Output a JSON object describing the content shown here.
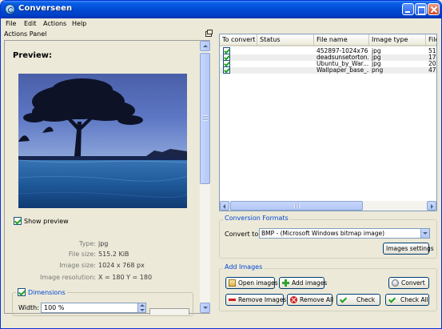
{
  "window": {
    "title": "Converseen"
  },
  "menu": [
    "File",
    "Edit",
    "Actions",
    "Help"
  ],
  "actions_panel": {
    "title": "Actions Panel",
    "preview_heading": "Preview:",
    "show_preview_label": "Show preview",
    "show_preview_checked": true,
    "info": [
      {
        "label": "Type:",
        "value": "jpg"
      },
      {
        "label": "File size:",
        "value": "515.2 KiB"
      },
      {
        "label": "Image size:",
        "value": "1024 x 768 px"
      },
      {
        "label": "Image resolution:",
        "value": "X = 180 Y = 180"
      }
    ],
    "dimensions_label": "Dimensions",
    "dimensions_checked": true,
    "width_label": "Width:",
    "width_value": "100 %"
  },
  "file_table": {
    "columns": [
      "To convert",
      "Status",
      "File name",
      "Image type",
      "File"
    ],
    "rows": [
      {
        "checked": true,
        "status": "",
        "file_name": "452897-1024x76...",
        "image_type": "jpg",
        "file": "51"
      },
      {
        "checked": true,
        "status": "",
        "file_name": "deadsunsetorton...",
        "image_type": "jpg",
        "file": "17"
      },
      {
        "checked": true,
        "status": "",
        "file_name": "Ubuntu_by_War...",
        "image_type": "jpg",
        "file": "20"
      },
      {
        "checked": true,
        "status": "",
        "file_name": "Wallpaper_base_...",
        "image_type": "png",
        "file": "47"
      }
    ]
  },
  "conversion_formats": {
    "title": "Conversion Formats",
    "convert_to_label": "Convert to:",
    "convert_to_value": "BMP - (Microsoft Windows bitmap image)",
    "images_settings_label": "Images settings"
  },
  "add_images": {
    "title": "Add Images",
    "open_images": "Open images",
    "add_images": "Add images",
    "convert": "Convert",
    "remove_images": "Remove Images",
    "remove_all": "Remove All",
    "check": "Check",
    "check_all": "Check All"
  }
}
